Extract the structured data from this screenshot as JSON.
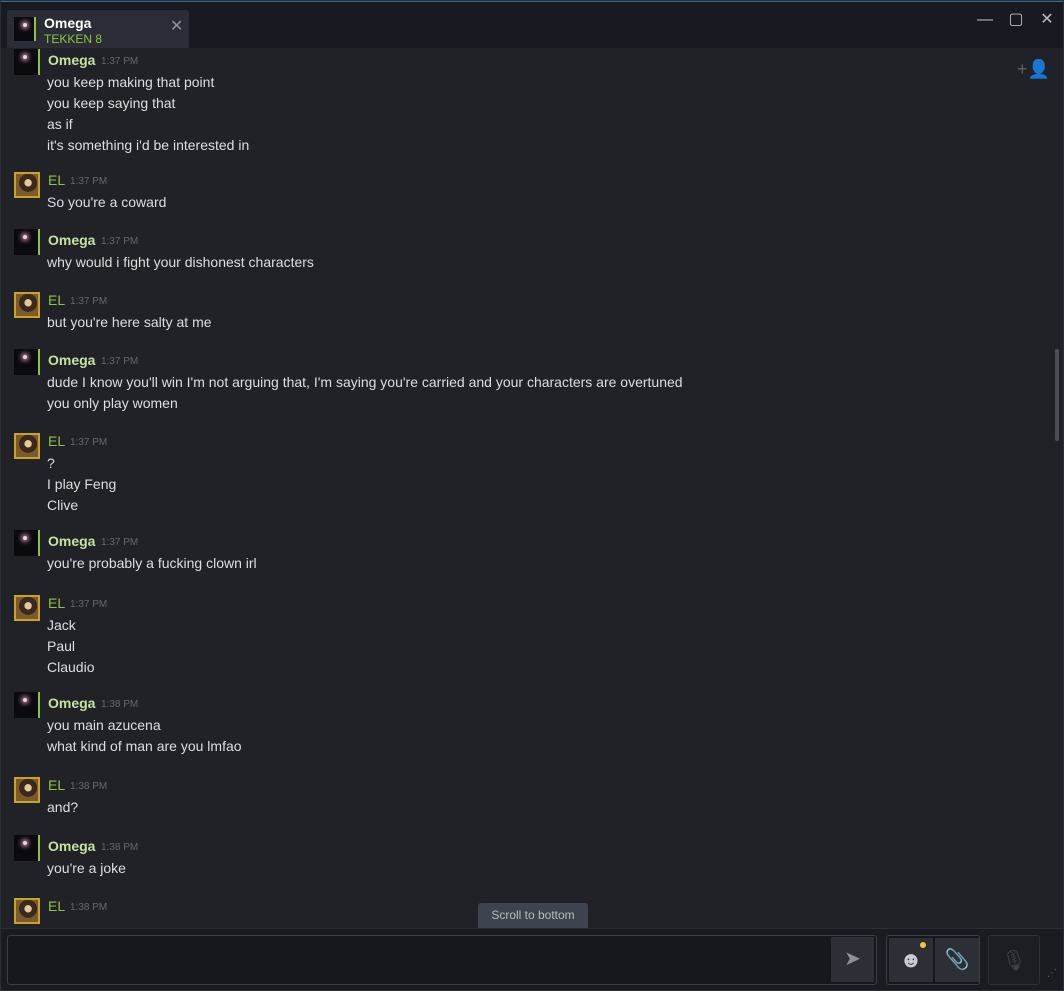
{
  "window": {
    "tab": {
      "name": "Omega",
      "game": "TEKKEN 8",
      "close": "✕"
    },
    "controls": {
      "minimize": "—",
      "maximize": "▢",
      "close": "✕"
    }
  },
  "messages": [
    {
      "author": "Omega",
      "time": "1:37 PM",
      "lines": [
        "you keep making that point",
        "you keep saying that",
        "as if",
        "it's something i'd be interested in"
      ]
    },
    {
      "author": "EL",
      "time": "1:37 PM",
      "lines": [
        "So you're a coward"
      ]
    },
    {
      "author": "Omega",
      "time": "1:37 PM",
      "lines": [
        "why would i fight your dishonest characters"
      ]
    },
    {
      "author": "EL",
      "time": "1:37 PM",
      "lines": [
        "but you're here salty at me"
      ]
    },
    {
      "author": "Omega",
      "time": "1:37 PM",
      "lines": [
        "dude I know you'll win I'm not arguing that, I'm saying you're carried and your characters are overtuned",
        "you only play women"
      ]
    },
    {
      "author": "EL",
      "time": "1:37 PM",
      "lines": [
        "?",
        "I play Feng",
        "Clive"
      ]
    },
    {
      "author": "Omega",
      "time": "1:37 PM",
      "lines": [
        "you're probably a fucking clown irl"
      ]
    },
    {
      "author": "EL",
      "time": "1:37 PM",
      "lines": [
        "Jack",
        "Paul",
        "Claudio"
      ]
    },
    {
      "author": "Omega",
      "time": "1:38 PM",
      "lines": [
        "you main azucena",
        "what kind of man are you lmfao"
      ]
    },
    {
      "author": "EL",
      "time": "1:38 PM",
      "lines": [
        "and?"
      ]
    },
    {
      "author": "Omega",
      "time": "1:38 PM",
      "lines": [
        "you're a joke"
      ]
    },
    {
      "author": "EL",
      "time": "1:38 PM",
      "lines": []
    }
  ],
  "scroll_to_bottom": "Scroll to bottom",
  "icons": {
    "send": "➤",
    "emoji": "☻",
    "attach": "📎",
    "voice": "🎙",
    "invite": "+👤",
    "grip": "⋰"
  },
  "colors": {
    "accent_green": "#8bc53f",
    "omega_name": "#c5e39d",
    "background": "#202227"
  }
}
